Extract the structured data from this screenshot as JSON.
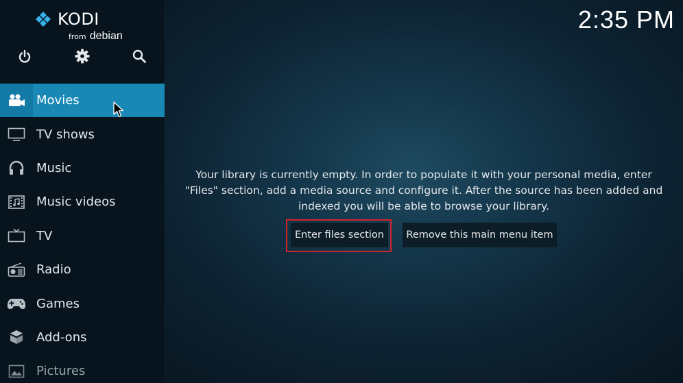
{
  "app": {
    "logo_title": "KODI",
    "logo_from": "from",
    "logo_distro": "debian",
    "clock": "2:35 PM"
  },
  "toolbar": {
    "icons": [
      "power-icon",
      "settings-gear-icon",
      "search-icon"
    ]
  },
  "sidebar": {
    "items": [
      {
        "label": "Movies",
        "icon": "movie-camera-icon",
        "active": true
      },
      {
        "label": "TV shows",
        "icon": "monitor-icon"
      },
      {
        "label": "Music",
        "icon": "headphones-icon"
      },
      {
        "label": "Music videos",
        "icon": "music-video-icon"
      },
      {
        "label": "TV",
        "icon": "tv-icon"
      },
      {
        "label": "Radio",
        "icon": "radio-icon"
      },
      {
        "label": "Games",
        "icon": "gamepad-icon"
      },
      {
        "label": "Add-ons",
        "icon": "addons-box-icon"
      },
      {
        "label": "Pictures",
        "icon": "picture-icon"
      }
    ]
  },
  "main": {
    "message_line1": "Your library is currently empty. In order to populate it with your personal media, enter",
    "message_line2": "\"Files\" section, add a media source and configure it. After the source has been added and",
    "message_line3": "indexed you will be able to browse your library.",
    "enter_files_label": "Enter files section",
    "remove_item_label": "Remove this main menu item"
  },
  "colors": {
    "accent": "#1a88b5",
    "highlight_box": "#d1232a",
    "sidebar_bg": "#07141d"
  }
}
